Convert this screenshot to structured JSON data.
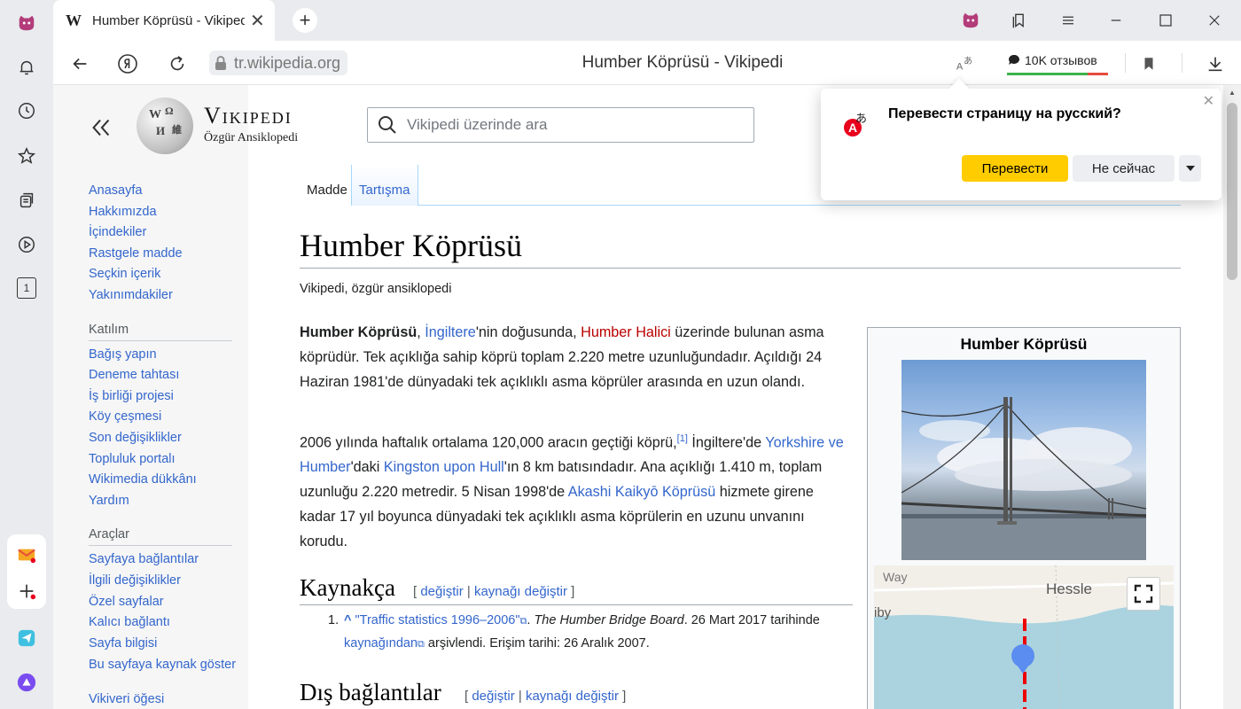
{
  "browser": {
    "tab_logo": "W",
    "tab_title": "Humber Köprüsü - Vikipedi",
    "tab_close": "✕",
    "new_tab": "+",
    "domain": "tr.wikipedia.org",
    "center_title": "Humber Köprüsü - Vikipedi",
    "reviews_label": "10K отзывов",
    "rail_badge": "1"
  },
  "translate_popup": {
    "question": "Перевести страницу на русский?",
    "translate_label": "Перевести",
    "not_now_label": "Не сейчас",
    "close": "✕"
  },
  "wiki": {
    "logo_word": "Vikipedi",
    "logo_tagline": "Özgür Ansiklopedi",
    "search_placeholder": "Vikipedi üzerinde ara",
    "nav_main": [
      "Anasayfa",
      "Hakkımızda",
      "İçindekiler",
      "Rastgele madde",
      "Seçkin içerik",
      "Yakınımdakiler"
    ],
    "group_participation": "Katılım",
    "nav_participation": [
      "Bağış yapın",
      "Deneme tahtası",
      "İş birliği projesi",
      "Köy çeşmesi",
      "Son değişiklikler",
      "Topluluk portalı",
      "Wikimedia dükkânı",
      "Yardım"
    ],
    "group_tools": "Araçlar",
    "nav_tools": [
      "Sayfaya bağlantılar",
      "İlgili değişiklikler",
      "Özel sayfalar",
      "Kalıcı bağlantı",
      "Sayfa bilgisi",
      "Bu sayfaya kaynak göster",
      "Vikiveri öğesi"
    ],
    "tab_article": "Madde",
    "tab_talk": "Tartışma",
    "title": "Humber Köprüsü",
    "tagline": "Vikipedi, özgür ansiklopedi",
    "p1": {
      "bold": "Humber Köprüsü",
      "t1": ", ",
      "link1": "İngiltere",
      "t2": "'nin doğusunda, ",
      "redlink": "Humber Halici",
      "t3": " üzerinde bulunan asma köprüdür. Tek açıklığa sahip köprü toplam 2.220 metre uzunluğundadır. Açıldığı 24 Haziran 1981'de dünyadaki tek açıklıklı asma köprüler arasında en uzun olandı."
    },
    "p2": {
      "t1": "2006 yılında haftalık ortalama 120,000 aracın geçtiği köprü,",
      "sup": "[1]",
      "t2": " İngiltere'de ",
      "link1": "Yorkshire ve Humber",
      "t3": "'daki ",
      "link2": "Kingston upon Hull",
      "t4": "'ın 8 km batısındadır. Ana açıklığı 1.410 m, toplam uzunluğu 2.220 metredir. 5 Nisan 1998'de ",
      "link3": "Akashi Kaikyō Köprüsü",
      "t5": " hizmete girene kadar 17 yıl boyunca dünyadaki tek açıklıklı asma köprülerin en uzunu unvanını korudu."
    },
    "h_refs": "Kaynakça",
    "h_ext": "Dış bağlantılar",
    "edit_open": "[ ",
    "edit": "değiştir",
    "edit_sep": " | ",
    "edit_source": "kaynağı değiştir",
    "edit_close": " ]",
    "ref": {
      "num": "1.",
      "caret": "^",
      "link": "\"Traffic statistics 1996–2006\"",
      "t1": ". ",
      "work": "The Humber Bridge Board",
      "t2": ". 26 Mart 2017 tarihinde ",
      "archive": "kaynağından",
      "t3": " arşivlendi. Erişim tarihi: 26 Aralık 2007."
    },
    "infobox_title": "Humber Köprüsü",
    "map_labels": {
      "a": "Way",
      "b": "Hessle",
      "c": "iby"
    }
  }
}
